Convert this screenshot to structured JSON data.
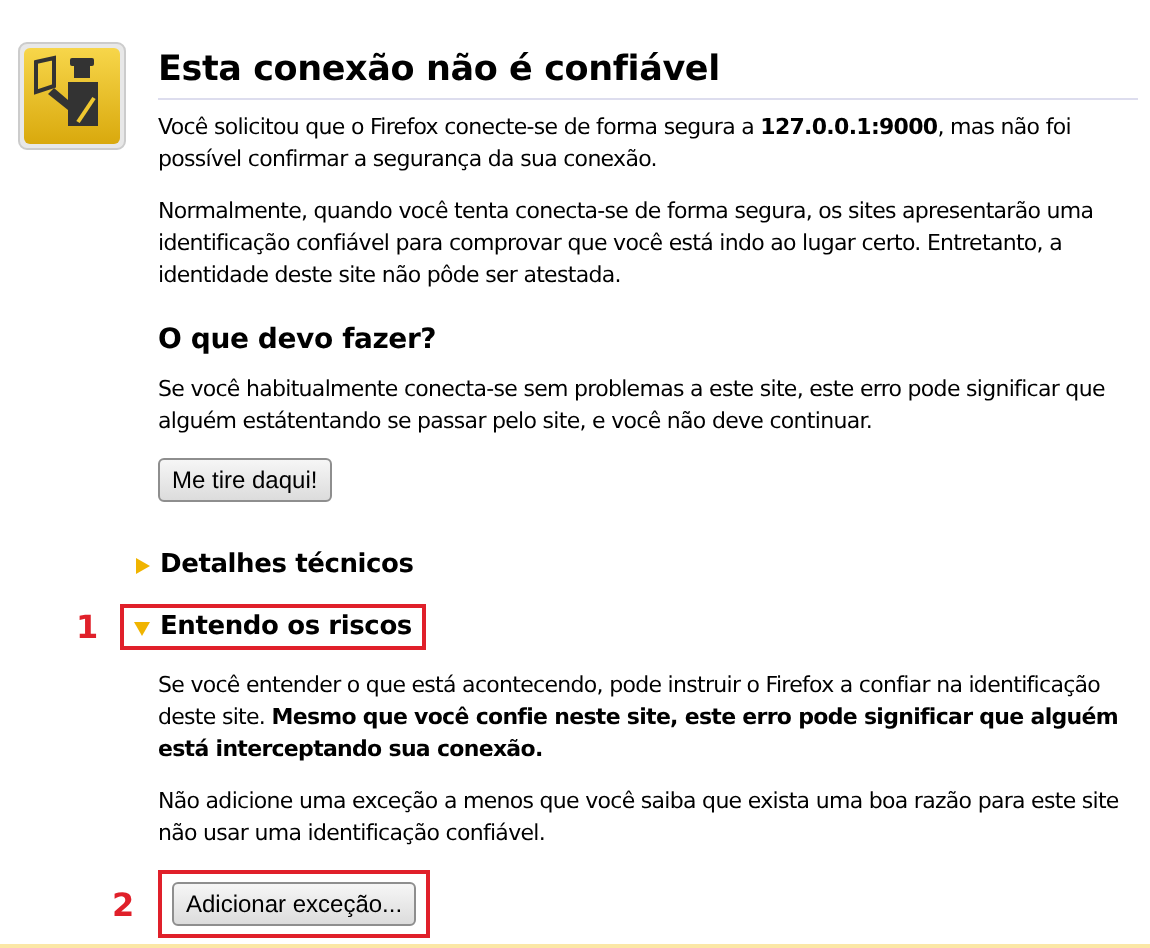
{
  "title": "Esta conexão não é confiável",
  "intro": [
    "Você solicitou que o Firefox conecte-se de forma segura a **127.0.0.1:9000**, mas não foi possível confirmar a segurança da sua conexão.",
    "Normalmente, quando você tenta conecta-se de forma segura, os sites apresentarão uma identificação confiável para comprovar que você está indo ao lugar certo. Entretanto, a identidade deste site não pôde ser atestada."
  ],
  "what_to_do": {
    "heading": "O que devo fazer?",
    "text": "Se você habitualmente conecta-se sem problemas a este site, este erro pode significar que alguém estátentando se passar pelo site, e você não deve continuar.",
    "button": "Me tire daqui!"
  },
  "sections": [
    {
      "heading": "Detalhes técnicos",
      "expanded": false
    },
    {
      "heading": "Entendo os riscos",
      "expanded": true,
      "annotation": "1",
      "paragraphs": [
        "Se você entender o que está acontecendo, pode instruir o Firefox a confiar na identificação deste site. **Mesmo que você confie neste site, este erro pode significar que alguém está interceptando sua conexão.**",
        "Não adicione uma exceção a menos que você saiba que exista uma boa razão para este site não usar uma identificação confiável."
      ],
      "button": {
        "label": "Adicionar exceção...",
        "annotation": "2"
      }
    }
  ]
}
